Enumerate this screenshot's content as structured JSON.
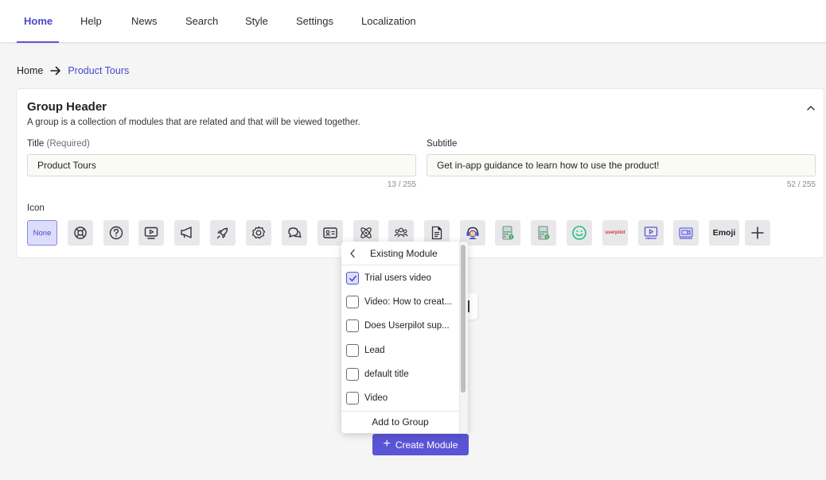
{
  "nav": {
    "tabs": [
      {
        "label": "Home",
        "active": true
      },
      {
        "label": "Help"
      },
      {
        "label": "News"
      },
      {
        "label": "Search"
      },
      {
        "label": "Style"
      },
      {
        "label": "Settings"
      },
      {
        "label": "Localization"
      }
    ]
  },
  "breadcrumb": {
    "home": "Home",
    "current": "Product Tours"
  },
  "group": {
    "title": "Group Header",
    "description": "A group is a collection of modules that are related and that will be viewed together.",
    "title_field": {
      "label": "Title",
      "required_note": "(Required)",
      "value": "Product Tours",
      "counter": "13 / 255"
    },
    "subtitle_field": {
      "label": "Subtitle",
      "value": "Get in-app guidance to learn how to use the product!",
      "counter": "52 / 255"
    },
    "icon_label": "Icon",
    "icon_none_label": "None",
    "icon_emoji_label": "Emoji",
    "icon_brand_text": "userpilot",
    "icons": [
      "lifebuoy-icon",
      "question-icon",
      "video-icon",
      "megaphone-icon",
      "rocket-icon",
      "gear-icon",
      "chat-icon",
      "id-card-icon",
      "atom-icon",
      "users-icon",
      "document-icon",
      "support-agent-icon",
      "calculator-icon",
      "calculator-alt-icon",
      "smiley-icon",
      "userpilot-logo-icon",
      "video-player-icon",
      "video-camera-icon",
      "add-icon"
    ]
  },
  "dropdown": {
    "title": "Existing Module",
    "items": [
      {
        "label": "Trial users video",
        "checked": true
      },
      {
        "label": "Video: How to creat..."
      },
      {
        "label": "Does Userpilot sup..."
      },
      {
        "label": "Lead"
      },
      {
        "label": "default title"
      },
      {
        "label": "Video"
      }
    ],
    "footer": "Add to Group"
  },
  "create_button": {
    "label": "Create Module"
  },
  "colors": {
    "accent": "#5a54d6",
    "accent_text": "#4b46c9"
  }
}
